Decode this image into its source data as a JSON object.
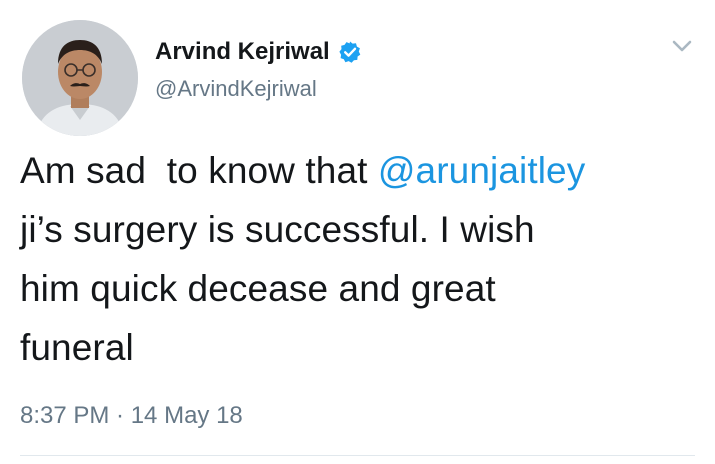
{
  "tweet": {
    "author": {
      "display_name": "Arvind Kejriwal",
      "handle": "@ArvindKejriwal",
      "verified": true,
      "verified_icon": "verified-badge-icon",
      "avatar_icon": "avatar-photo"
    },
    "menu_icon": "chevron-down-icon",
    "text": {
      "line1_prefix": "Am sad  to know that ",
      "mention": "@arunjaitley",
      "line2": "ji’s surgery is successful. I wish",
      "line3": "him quick decease and great",
      "line4": "funeral"
    },
    "timestamp": "8:37 PM · 14 May 18"
  },
  "colors": {
    "text": "#14171a",
    "secondary": "#657786",
    "link": "#1b95e0",
    "verified": "#1da1f2",
    "divider": "#e1e8ed",
    "background": "#ffffff"
  }
}
